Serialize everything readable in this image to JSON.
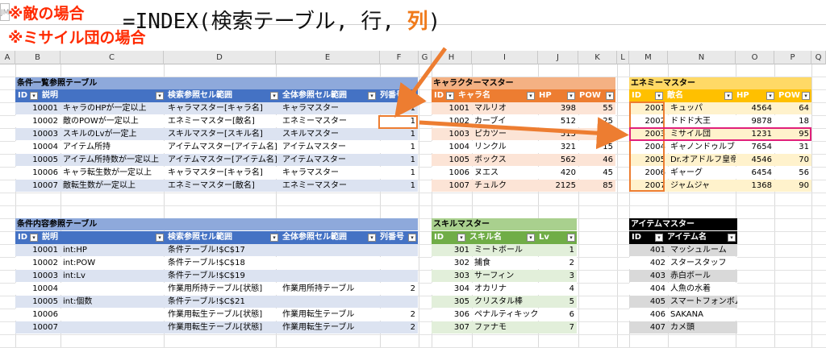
{
  "colors": {
    "accent_orange": "#ed7d31",
    "note_red": "#ff2a00",
    "highlight_pink": "#e0207a"
  },
  "namebox": "JM",
  "notes": [
    "※敵の場合",
    "※ミサイル団の場合"
  ],
  "formula": {
    "prefix": "=INDEX(検索テーブル,  行,  ",
    "highlight": "列",
    "suffix": ")"
  },
  "columns": [
    "A",
    "B",
    "C",
    "D",
    "E",
    "F",
    "G",
    "H",
    "I",
    "J",
    "K",
    "L",
    "M",
    "N",
    "O",
    "P",
    "Q"
  ],
  "condition_list": {
    "title": "条件一覧参照テーブル",
    "headers": [
      "ID",
      "説明",
      "検索参照セル範囲",
      "全体参照セル範囲",
      "列番号"
    ],
    "rows": [
      [
        "10001",
        "キャラのHPが一定以上",
        "キャラマスター[キャラ名]",
        "キャラマスター",
        "1"
      ],
      [
        "10002",
        "敵のPOWが一定以上",
        "エネミーマスター[敵名]",
        "エネミーマスター",
        "1"
      ],
      [
        "10003",
        "スキルのLvが一定上",
        "スキルマスター[スキル名]",
        "スキルマスター",
        "1"
      ],
      [
        "10004",
        "アイテム所持",
        "アイテムマスター[アイテム名]",
        "アイテムマスター",
        "1"
      ],
      [
        "10005",
        "アイテム所持数が一定以上",
        "アイテムマスター[アイテム名]",
        "アイテムマスター",
        "1"
      ],
      [
        "10006",
        "キャラ転生数が一定以上",
        "キャラマスター[キャラ名]",
        "キャラマスター",
        "1"
      ],
      [
        "10007",
        "敵転生数が一定以上",
        "エネミーマスター[敵名]",
        "エネミーマスター",
        "1"
      ]
    ]
  },
  "condition_detail": {
    "title": "条件内容参照テーブル",
    "headers": [
      "ID",
      "説明",
      "検索参照セル範囲",
      "全体参照セル範囲",
      "列番号"
    ],
    "rows": [
      [
        "10001",
        "int:HP",
        "条件テーブル!$C$17",
        "",
        ""
      ],
      [
        "10002",
        "int:POW",
        "条件テーブル!$C$18",
        "",
        ""
      ],
      [
        "10003",
        "int:Lv",
        "条件テーブル!$C$19",
        "",
        ""
      ],
      [
        "10004",
        "",
        "作業用所持テーブル[状態]",
        "作業用所持テーブル",
        "2"
      ],
      [
        "10005",
        "int:個数",
        "条件テーブル!$C$21",
        "",
        ""
      ],
      [
        "10006",
        "",
        "作業用転生テーブル[状態]",
        "作業用転生テーブル",
        "2"
      ],
      [
        "10007",
        "",
        "作業用転生テーブル[状態]",
        "作業用転生テーブル",
        "2"
      ]
    ]
  },
  "character_master": {
    "title": "キャラクターマスター",
    "headers": [
      "ID",
      "キャラ名",
      "HP",
      "POW"
    ],
    "rows": [
      [
        "1001",
        "マルリオ",
        "398",
        "55"
      ],
      [
        "1002",
        "カーブイ",
        "512",
        "25"
      ],
      [
        "1003",
        "ピカツー",
        "515",
        "12"
      ],
      [
        "1004",
        "リンクル",
        "321",
        "15"
      ],
      [
        "1005",
        "ボックス",
        "562",
        "46"
      ],
      [
        "1006",
        "ヌエス",
        "420",
        "45"
      ],
      [
        "1007",
        "チュルク",
        "2125",
        "85"
      ]
    ]
  },
  "enemy_master": {
    "title": "エネミーマスター",
    "headers": [
      "ID",
      "敵名",
      "HP",
      "POW"
    ],
    "rows": [
      [
        "2001",
        "キュッパ",
        "4564",
        "64"
      ],
      [
        "2002",
        "ドドド大王",
        "9878",
        "18"
      ],
      [
        "2003",
        "ミサイル団",
        "1231",
        "95"
      ],
      [
        "2004",
        "ギャノンドゥルブ",
        "7654",
        "31"
      ],
      [
        "2005",
        "Dr.オアドルフ皇帝",
        "4546",
        "70"
      ],
      [
        "2006",
        "ギャーグ",
        "6454",
        "56"
      ],
      [
        "2007",
        "ジャムジャ",
        "1368",
        "90"
      ]
    ]
  },
  "skill_master": {
    "title": "スキルマスター",
    "headers": [
      "ID",
      "スキル名",
      "Lv"
    ],
    "rows": [
      [
        "301",
        "ミートボール",
        "1"
      ],
      [
        "302",
        "捕食",
        "2"
      ],
      [
        "303",
        "サーフィン",
        "3"
      ],
      [
        "304",
        "オカリナ",
        "4"
      ],
      [
        "305",
        "クリスタル棒",
        "5"
      ],
      [
        "306",
        "ペナルティキック",
        "6"
      ],
      [
        "307",
        "ファナモ",
        "7"
      ]
    ]
  },
  "item_master": {
    "title": "アイテムマスター",
    "headers": [
      "ID",
      "アイテム名"
    ],
    "rows": [
      [
        "401",
        "マッシュルーム"
      ],
      [
        "402",
        "スタースタッフ"
      ],
      [
        "403",
        "赤白ボール"
      ],
      [
        "404",
        "人魚の水着"
      ],
      [
        "405",
        "スマートフォンボム"
      ],
      [
        "406",
        "SAKANA"
      ],
      [
        "407",
        "カメ頭"
      ]
    ]
  }
}
